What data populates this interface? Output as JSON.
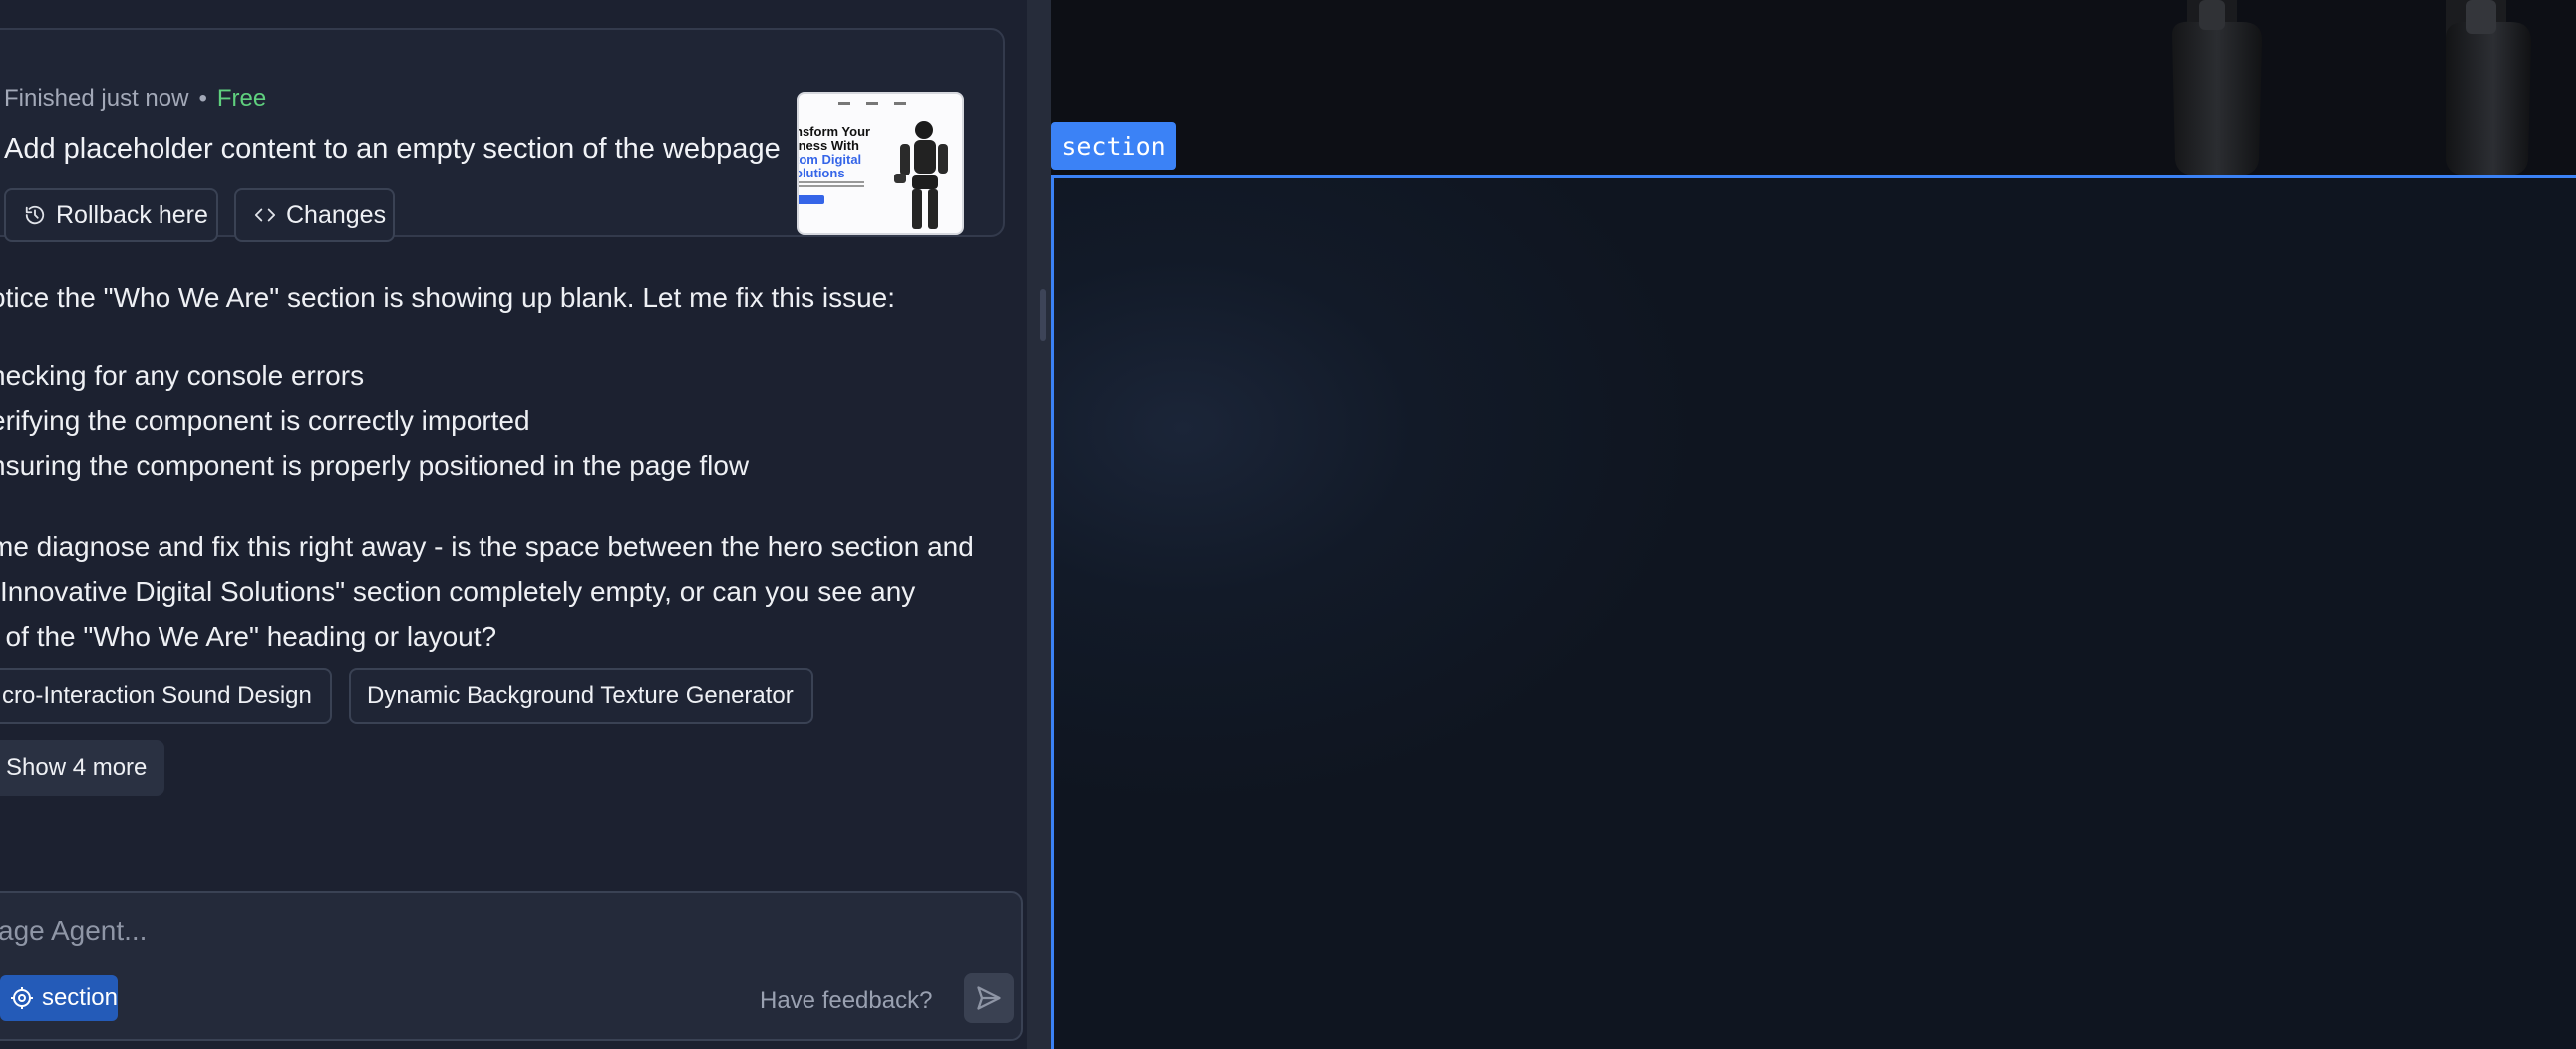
{
  "checkpoint": {
    "status": "Finished just now",
    "separator": "•",
    "price": "Free",
    "title": "Add placeholder content to an empty section of the webpage",
    "rollback_label": "Rollback here",
    "changes_label": "Changes",
    "thumbnail": {
      "headline_lines": [
        "nsform Your",
        "iness With"
      ],
      "headline_blue_lines": [
        "tom Digital",
        "olutions"
      ]
    }
  },
  "message": {
    "intro": "otice the \"Who We Are\" section is showing up blank. Let me fix this issue:",
    "list": [
      "hecking for any console errors",
      "erifying the component is correctly imported",
      "nsuring the component is properly positioned in the page flow"
    ],
    "question_lines": [
      "me diagnose and fix this right away - is the space between the hero section and",
      "\"Innovative Digital Solutions\" section completely empty, or can you see any",
      "t of the \"Who We Are\" heading or layout?"
    ]
  },
  "suggestions": {
    "chips": [
      "cro-Interaction Sound Design",
      "Dynamic Background Texture Generator"
    ],
    "show_more_label": "Show 4 more"
  },
  "composer": {
    "placeholder": "ssage Agent...",
    "section_chip_label": "section",
    "feedback_label": "Have feedback?"
  },
  "preview": {
    "section_tag": "section"
  },
  "colors": {
    "accent": "#3b82f6",
    "free": "#5fd07e",
    "panel_bg": "#1c2130",
    "preview_bg": "#0f1118"
  }
}
